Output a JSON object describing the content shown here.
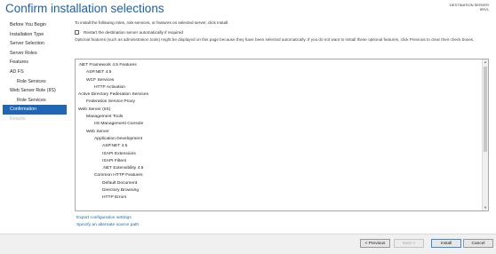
{
  "header": {
    "title": "Confirm installation selections",
    "destination_label": "DESTINATION SERVER",
    "destination_server": "SRV1"
  },
  "sidebar": {
    "items": [
      {
        "label": "Before You Begin",
        "state": "normal"
      },
      {
        "label": "Installation Type",
        "state": "normal"
      },
      {
        "label": "Server Selection",
        "state": "normal"
      },
      {
        "label": "Server Roles",
        "state": "normal"
      },
      {
        "label": "Features",
        "state": "normal"
      },
      {
        "label": "AD FS",
        "state": "normal"
      },
      {
        "label": "Role Services",
        "state": "normal"
      },
      {
        "label": "Web Server Role (IIS)",
        "state": "normal"
      },
      {
        "label": "Role Services",
        "state": "normal"
      },
      {
        "label": "Confirmation",
        "state": "active"
      },
      {
        "label": "Results",
        "state": "disabled"
      }
    ]
  },
  "main": {
    "intro": "To install the following roles, role services, or features on selected server, click Install.",
    "restart_label": "Restart the destination server automatically if required",
    "optional_note": "Optional features (such as administration tools) might be displayed on this page because they have been selected automatically. If you do not want to install these optional features, click Previous to clear their check boxes.",
    "features": [
      ".NET Framework 4.5 Features",
      "ASP.NET 4.5",
      "WCF Services",
      "HTTP Activation",
      "Active Directory Federation Services",
      "Federation Service Proxy",
      "Web Server (IIS)",
      "Management Tools",
      "IIS Management Console",
      "Web Server",
      "Application Development",
      "ASP.NET 4.5",
      "ISAPI Extensions",
      "ISAPI Filters",
      ".NET Extensibility 4.5",
      "Common HTTP Features",
      "Default Document",
      "Directory Browsing",
      "HTTP Errors"
    ],
    "export_link": "Export configuration settings",
    "alternate_source_link": "Specify an alternate source path"
  },
  "footer": {
    "previous": "< Previous",
    "next": "Next >",
    "install": "Install",
    "cancel": "Cancel"
  }
}
